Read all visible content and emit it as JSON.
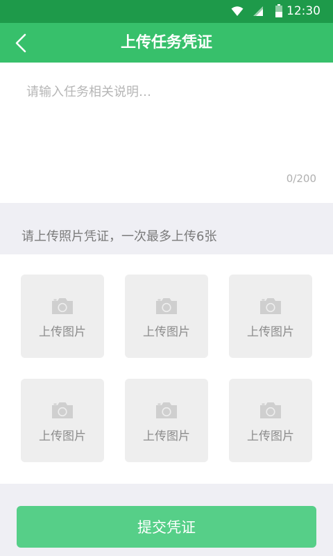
{
  "status_bar": {
    "time": "12:30"
  },
  "header": {
    "title": "上传任务凭证",
    "back_icon": "chevron-left-icon"
  },
  "description": {
    "placeholder": "请输入任务相关说明…",
    "value": "",
    "char_count": "0/200"
  },
  "upload": {
    "hint": "请上传照片凭证，一次最多上传6张",
    "slots": [
      {
        "label": "上传图片",
        "icon": "camera-icon"
      },
      {
        "label": "上传图片",
        "icon": "camera-icon"
      },
      {
        "label": "上传图片",
        "icon": "camera-icon"
      },
      {
        "label": "上传图片",
        "icon": "camera-icon"
      },
      {
        "label": "上传图片",
        "icon": "camera-icon"
      },
      {
        "label": "上传图片",
        "icon": "camera-icon"
      }
    ]
  },
  "submit": {
    "label": "提交凭证"
  },
  "colors": {
    "status_bar": "#1e9a4a",
    "header": "#37c06b",
    "submit": "#56cf88",
    "page_bg": "#efeff4"
  }
}
